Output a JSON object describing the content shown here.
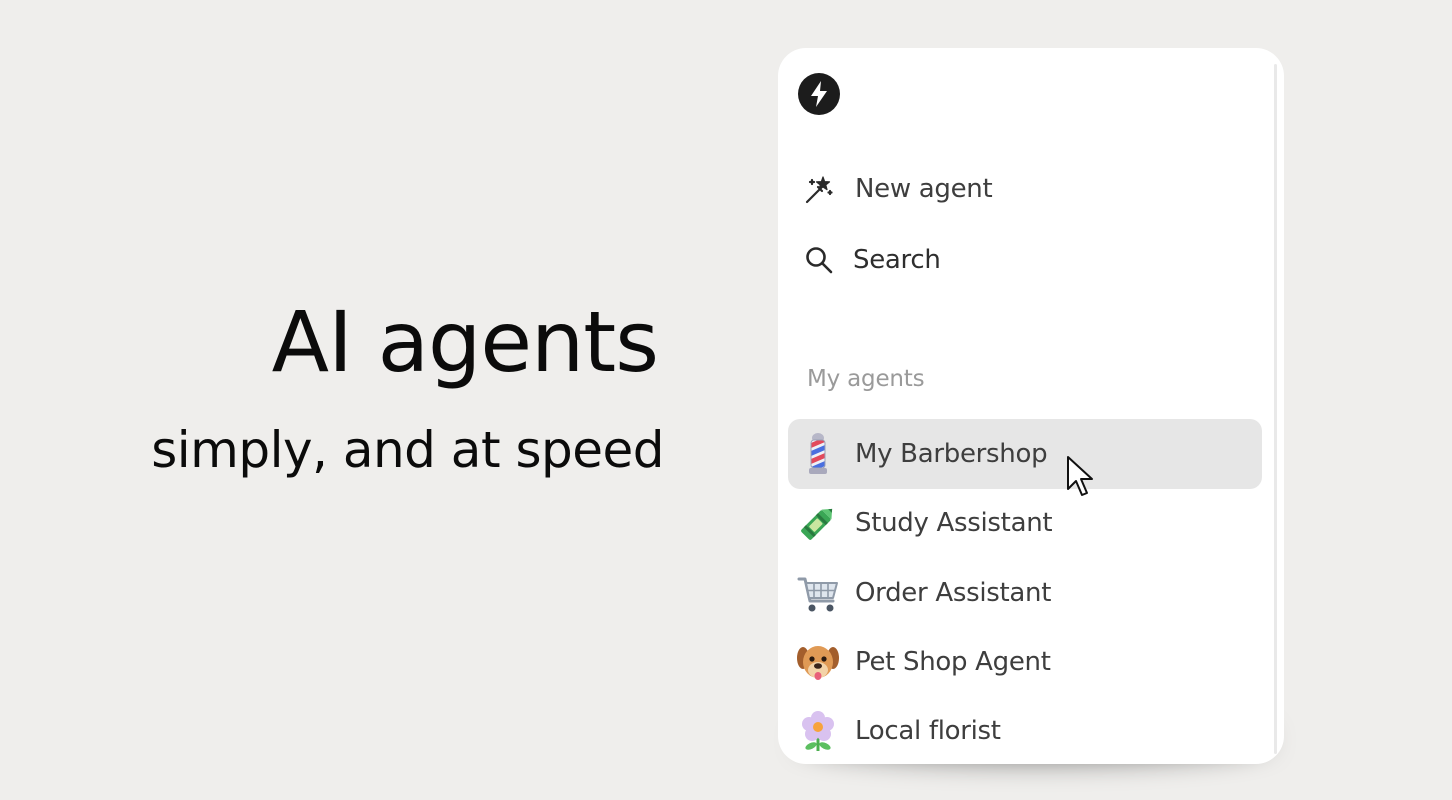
{
  "hero": {
    "title": "AI agents",
    "subtitle": "simply, and at speed"
  },
  "sidebar": {
    "logo_icon": "lightning-bolt-icon",
    "actions": [
      {
        "label": "New agent",
        "icon": "magic-wand-icon"
      },
      {
        "label": "Search",
        "icon": "search-icon"
      }
    ],
    "section_label": "My agents",
    "agents": [
      {
        "label": "My Barbershop",
        "icon": "barber-pole-icon",
        "selected": true
      },
      {
        "label": "Study Assistant",
        "icon": "crayon-icon",
        "selected": false
      },
      {
        "label": "Order Assistant",
        "icon": "shopping-cart-icon",
        "selected": false
      },
      {
        "label": "Pet Shop Agent",
        "icon": "dog-face-icon",
        "selected": false
      },
      {
        "label": "Local florist",
        "icon": "flower-icon",
        "selected": false
      }
    ]
  },
  "colors": {
    "background": "#efeeec",
    "panel": "#ffffff",
    "selected_row": "#e6e6e6",
    "text_primary": "#0b0b0b",
    "text_menu": "#3e3e3e",
    "text_muted": "#9a9a9a"
  }
}
